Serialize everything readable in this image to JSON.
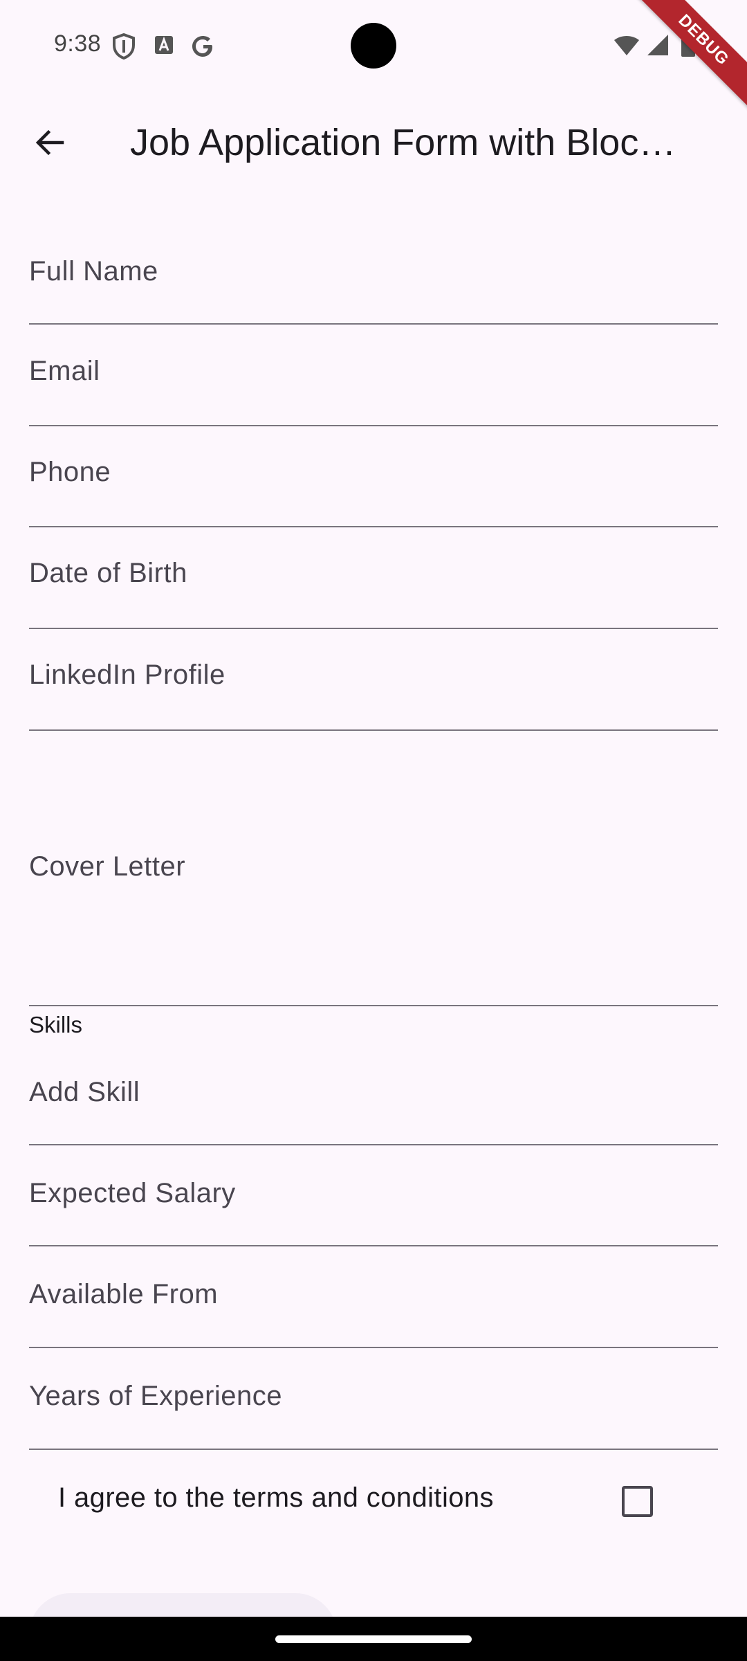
{
  "status_bar": {
    "time": "9:38",
    "left_icons": [
      "shield-icon",
      "font-icon",
      "google-icon"
    ],
    "right_icons": [
      "wifi-icon",
      "signal-icon",
      "battery-icon"
    ],
    "debug_banner": "DEBUG"
  },
  "app_bar": {
    "title": "Job Application Form with Bloc…",
    "back_icon": "arrow-back-icon"
  },
  "form": {
    "full_name_label": "Full Name",
    "email_label": "Email",
    "phone_label": "Phone",
    "dob_label": "Date of Birth",
    "linkedin_label": "LinkedIn Profile",
    "cover_letter_label": "Cover Letter",
    "skills_section_label": "Skills",
    "add_skill_label": "Add Skill",
    "salary_label": "Expected Salary",
    "available_from_label": "Available From",
    "experience_label": "Years of Experience",
    "terms_label": "I agree to the terms and conditions",
    "terms_checked": false
  },
  "colors": {
    "background": "#fdf7fd",
    "underline": "#79747e",
    "label": "#49454f",
    "debug": "#b3262d"
  }
}
